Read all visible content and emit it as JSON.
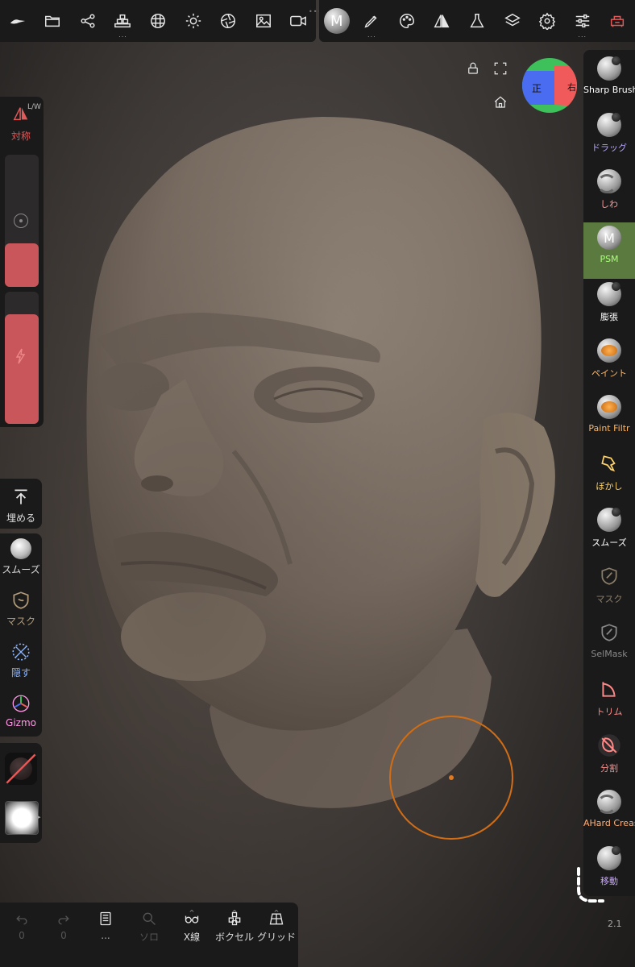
{
  "symmetry": {
    "label": "対称",
    "mode": "L/W"
  },
  "left_tools": {
    "fill": "埋める",
    "smooth": "スムーズ",
    "mask": "マスク",
    "hide": "隠す",
    "gizmo": "Gizmo"
  },
  "right_tools": [
    {
      "label": "Sharp Brush",
      "color": "#ffffff"
    },
    {
      "label": "ドラッグ",
      "color": "#b4a2ff"
    },
    {
      "label": "しわ",
      "color": "#ff9b9b"
    },
    {
      "label": "PSM",
      "color": "#a8ff7a"
    },
    {
      "label": "膨張",
      "color": "#ffffff"
    },
    {
      "label": "ペイント",
      "color": "#ffb560"
    },
    {
      "label": "Paint Filtr",
      "color": "#ffb560"
    },
    {
      "label": "ぼかし",
      "color": "#ffd36a"
    },
    {
      "label": "スムーズ",
      "color": "#ffffff"
    },
    {
      "label": "マスク",
      "color": "#8a7e6a"
    },
    {
      "label": "SelMask",
      "color": "#8a8a8a"
    },
    {
      "label": "トリム",
      "color": "#ff8a8a"
    },
    {
      "label": "分割",
      "color": "#ff8a8a"
    },
    {
      "label": "AHard Crease",
      "color": "#ffb07a"
    },
    {
      "label": "移動",
      "color": "#c9a6ff"
    }
  ],
  "bottom": {
    "undo_count": "0",
    "redo_count": "0",
    "scene_dots": "...",
    "solo": "ソロ",
    "xray": "X線",
    "voxel": "ボクセル",
    "grid": "グリッド"
  },
  "viewcube": {
    "front": "正",
    "right": "右"
  },
  "version": "2.1",
  "material_letter": "M",
  "psm_letter": "M",
  "accent": "#c9565a",
  "brush_color": "#d06d15"
}
